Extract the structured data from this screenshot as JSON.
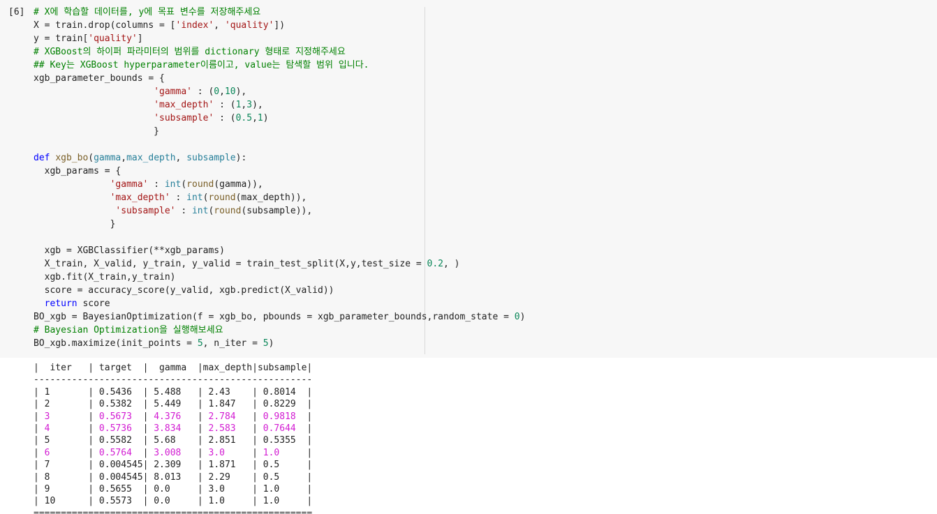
{
  "cell": {
    "prompt": "[6]",
    "code_lines": [
      [
        {
          "t": "# X에 학습할 데이터를, y에 목표 변수를 저장해주세요",
          "c": "comment"
        }
      ],
      [
        {
          "t": "X = train.drop(columns = [",
          "c": "plain"
        },
        {
          "t": "'index'",
          "c": "string"
        },
        {
          "t": ", ",
          "c": "plain"
        },
        {
          "t": "'quality'",
          "c": "string"
        },
        {
          "t": "])",
          "c": "plain"
        }
      ],
      [
        {
          "t": "y = train[",
          "c": "plain"
        },
        {
          "t": "'quality'",
          "c": "string"
        },
        {
          "t": "]",
          "c": "plain"
        }
      ],
      [
        {
          "t": "# XGBoost의 하이퍼 파라미터의 범위를 dictionary 형태로 지정해주세요",
          "c": "comment"
        }
      ],
      [
        {
          "t": "## Key는 XGBoost hyperparameter이름이고, value는 탐색할 범위 입니다.",
          "c": "comment"
        }
      ],
      [
        {
          "t": "xgb_parameter_bounds = {",
          "c": "plain"
        }
      ],
      [
        {
          "t": "                      ",
          "c": "plain"
        },
        {
          "t": "'gamma'",
          "c": "string"
        },
        {
          "t": " : (",
          "c": "plain"
        },
        {
          "t": "0",
          "c": "number"
        },
        {
          "t": ",",
          "c": "plain"
        },
        {
          "t": "10",
          "c": "number"
        },
        {
          "t": "),",
          "c": "plain"
        }
      ],
      [
        {
          "t": "                      ",
          "c": "plain"
        },
        {
          "t": "'max_depth'",
          "c": "string"
        },
        {
          "t": " : (",
          "c": "plain"
        },
        {
          "t": "1",
          "c": "number"
        },
        {
          "t": ",",
          "c": "plain"
        },
        {
          "t": "3",
          "c": "number"
        },
        {
          "t": "),",
          "c": "plain"
        }
      ],
      [
        {
          "t": "                      ",
          "c": "plain"
        },
        {
          "t": "'subsample'",
          "c": "string"
        },
        {
          "t": " : (",
          "c": "plain"
        },
        {
          "t": "0.5",
          "c": "number"
        },
        {
          "t": ",",
          "c": "plain"
        },
        {
          "t": "1",
          "c": "number"
        },
        {
          "t": ")",
          "c": "plain"
        }
      ],
      [
        {
          "t": "                      }",
          "c": "plain"
        }
      ],
      [
        {
          "t": "",
          "c": "plain"
        }
      ],
      [
        {
          "t": "def",
          "c": "keyword"
        },
        {
          "t": " ",
          "c": "plain"
        },
        {
          "t": "xgb_bo",
          "c": "func"
        },
        {
          "t": "(",
          "c": "plain"
        },
        {
          "t": "gamma",
          "c": "builtin"
        },
        {
          "t": ",",
          "c": "plain"
        },
        {
          "t": "max_depth",
          "c": "builtin"
        },
        {
          "t": ", ",
          "c": "plain"
        },
        {
          "t": "subsample",
          "c": "builtin"
        },
        {
          "t": "):",
          "c": "plain"
        }
      ],
      [
        {
          "t": "  xgb_params = {",
          "c": "plain"
        }
      ],
      [
        {
          "t": "              ",
          "c": "plain"
        },
        {
          "t": "'gamma'",
          "c": "string"
        },
        {
          "t": " : ",
          "c": "plain"
        },
        {
          "t": "int",
          "c": "builtin"
        },
        {
          "t": "(",
          "c": "plain"
        },
        {
          "t": "round",
          "c": "func"
        },
        {
          "t": "(gamma)),",
          "c": "plain"
        }
      ],
      [
        {
          "t": "              ",
          "c": "plain"
        },
        {
          "t": "'max_depth'",
          "c": "string"
        },
        {
          "t": " : ",
          "c": "plain"
        },
        {
          "t": "int",
          "c": "builtin"
        },
        {
          "t": "(",
          "c": "plain"
        },
        {
          "t": "round",
          "c": "func"
        },
        {
          "t": "(max_depth)),",
          "c": "plain"
        }
      ],
      [
        {
          "t": "               ",
          "c": "plain"
        },
        {
          "t": "'subsample'",
          "c": "string"
        },
        {
          "t": " : ",
          "c": "plain"
        },
        {
          "t": "int",
          "c": "builtin"
        },
        {
          "t": "(",
          "c": "plain"
        },
        {
          "t": "round",
          "c": "func"
        },
        {
          "t": "(subsample)),",
          "c": "plain"
        }
      ],
      [
        {
          "t": "              }",
          "c": "plain"
        }
      ],
      [
        {
          "t": "",
          "c": "plain"
        }
      ],
      [
        {
          "t": "  xgb = XGBClassifier(**xgb_params)",
          "c": "plain"
        }
      ],
      [
        {
          "t": "  X_train, X_valid, y_train, y_valid = train_test_split(X,y,test_size = ",
          "c": "plain"
        },
        {
          "t": "0.2",
          "c": "number"
        },
        {
          "t": ", )",
          "c": "plain"
        }
      ],
      [
        {
          "t": "  xgb.fit(X_train,y_train)",
          "c": "plain"
        }
      ],
      [
        {
          "t": "  score = accuracy_score(y_valid, xgb.predict(X_valid))",
          "c": "plain"
        }
      ],
      [
        {
          "t": "  ",
          "c": "plain"
        },
        {
          "t": "return",
          "c": "keyword"
        },
        {
          "t": " score",
          "c": "plain"
        }
      ],
      [
        {
          "t": "BO_xgb = BayesianOptimization(f = xgb_bo, pbounds = xgb_parameter_bounds,random_state = ",
          "c": "plain"
        },
        {
          "t": "0",
          "c": "number"
        },
        {
          "t": ")",
          "c": "plain"
        }
      ],
      [
        {
          "t": "# Bayesian Optimization을 실행해보세요",
          "c": "comment"
        }
      ],
      [
        {
          "t": "BO_xgb.maximize(init_points = ",
          "c": "plain"
        },
        {
          "t": "5",
          "c": "number"
        },
        {
          "t": ", n_iter = ",
          "c": "plain"
        },
        {
          "t": "5",
          "c": "number"
        },
        {
          "t": ")",
          "c": "plain"
        }
      ]
    ]
  },
  "output": {
    "header": [
      "iter",
      "target",
      "gamma",
      "max_depth",
      "subsample"
    ],
    "rows": [
      {
        "cells": [
          "1",
          "0.5436",
          "5.488",
          "2.43",
          "0.8014"
        ],
        "highlight": false
      },
      {
        "cells": [
          "2",
          "0.5382",
          "5.449",
          "1.847",
          "0.8229"
        ],
        "highlight": false
      },
      {
        "cells": [
          "3",
          "0.5673",
          "4.376",
          "2.784",
          "0.9818"
        ],
        "highlight": true
      },
      {
        "cells": [
          "4",
          "0.5736",
          "3.834",
          "2.583",
          "0.7644"
        ],
        "highlight": true
      },
      {
        "cells": [
          "5",
          "0.5582",
          "5.68",
          "2.851",
          "0.5355"
        ],
        "highlight": false
      },
      {
        "cells": [
          "6",
          "0.5764",
          "3.008",
          "3.0",
          "1.0"
        ],
        "highlight": true
      },
      {
        "cells": [
          "7",
          "0.004545",
          "2.309",
          "1.871",
          "0.5"
        ],
        "highlight": false
      },
      {
        "cells": [
          "8",
          "0.004545",
          "8.013",
          "2.29",
          "0.5"
        ],
        "highlight": false
      },
      {
        "cells": [
          "9",
          "0.5655",
          "0.0",
          "3.0",
          "1.0"
        ],
        "highlight": false
      },
      {
        "cells": [
          "10",
          "0.5573",
          "0.0",
          "1.0",
          "1.0"
        ],
        "highlight": false
      }
    ],
    "highlight_color": "#d21bd2"
  }
}
